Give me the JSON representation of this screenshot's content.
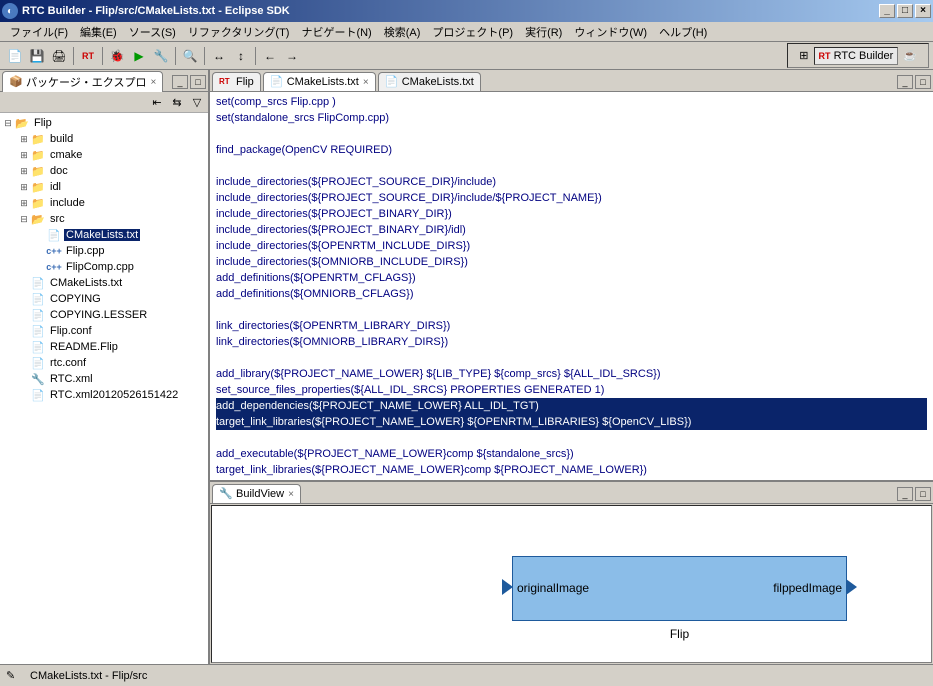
{
  "title": "RTC Builder - Flip/src/CMakeLists.txt - Eclipse SDK",
  "menu": [
    "ファイル(F)",
    "編集(E)",
    "ソース(S)",
    "リファクタリング(T)",
    "ナビゲート(N)",
    "検索(A)",
    "プロジェクト(P)",
    "実行(R)",
    "ウィンドウ(W)",
    "ヘルプ(H)"
  ],
  "perspective": {
    "label": "RTC Builder"
  },
  "left": {
    "tab": "パッケージ・エクスプロ",
    "root": "Flip",
    "folders": [
      "build",
      "cmake",
      "doc",
      "idl",
      "include"
    ],
    "srcFolder": "src",
    "srcFiles": [
      {
        "name": "CMakeLists.txt",
        "icon": "file",
        "selected": true
      },
      {
        "name": "Flip.cpp",
        "icon": "cpp"
      },
      {
        "name": "FlipComp.cpp",
        "icon": "cpp"
      }
    ],
    "rootFiles": [
      "CMakeLists.txt",
      "COPYING",
      "COPYING.LESSER",
      "Flip.conf",
      "README.Flip",
      "rtc.conf"
    ],
    "rtcxml": "RTC.xml",
    "rtcxmlbak": "RTC.xml20120526151422"
  },
  "editorTabs": [
    {
      "label": "Flip",
      "active": false,
      "closable": false,
      "icon": "rt"
    },
    {
      "label": "CMakeLists.txt",
      "active": true,
      "closable": true,
      "icon": "file"
    },
    {
      "label": "CMakeLists.txt",
      "active": false,
      "closable": false,
      "icon": "file"
    }
  ],
  "code": {
    "pre": "set(comp_srcs Flip.cpp )\nset(standalone_srcs FlipComp.cpp)\n\nfind_package(OpenCV REQUIRED)\n\ninclude_directories(${PROJECT_SOURCE_DIR}/include)\ninclude_directories(${PROJECT_SOURCE_DIR}/include/${PROJECT_NAME})\ninclude_directories(${PROJECT_BINARY_DIR})\ninclude_directories(${PROJECT_BINARY_DIR}/idl)\ninclude_directories(${OPENRTM_INCLUDE_DIRS})\ninclude_directories(${OMNIORB_INCLUDE_DIRS})\nadd_definitions(${OPENRTM_CFLAGS})\nadd_definitions(${OMNIORB_CFLAGS})\n\nlink_directories(${OPENRTM_LIBRARY_DIRS})\nlink_directories(${OMNIORB_LIBRARY_DIRS})\n\nadd_library(${PROJECT_NAME_LOWER} ${LIB_TYPE} ${comp_srcs} ${ALL_IDL_SRCS})\nset_source_files_properties(${ALL_IDL_SRCS} PROPERTIES GENERATED 1)",
    "hl1": "add_dependencies(${PROJECT_NAME_LOWER} ALL_IDL_TGT)",
    "hl2": "target_link_libraries(${PROJECT_NAME_LOWER} ${OPENRTM_LIBRARIES} ${OpenCV_LIBS})",
    "post": "\nadd_executable(${PROJECT_NAME_LOWER}comp ${standalone_srcs})\ntarget_link_libraries(${PROJECT_NAME_LOWER}comp ${PROJECT_NAME_LOWER})\n"
  },
  "buildview": {
    "tab": "BuildView",
    "component": "Flip",
    "portLeft": "originalImage",
    "portRight": "filppedImage"
  },
  "status": "CMakeLists.txt - Flip/src"
}
